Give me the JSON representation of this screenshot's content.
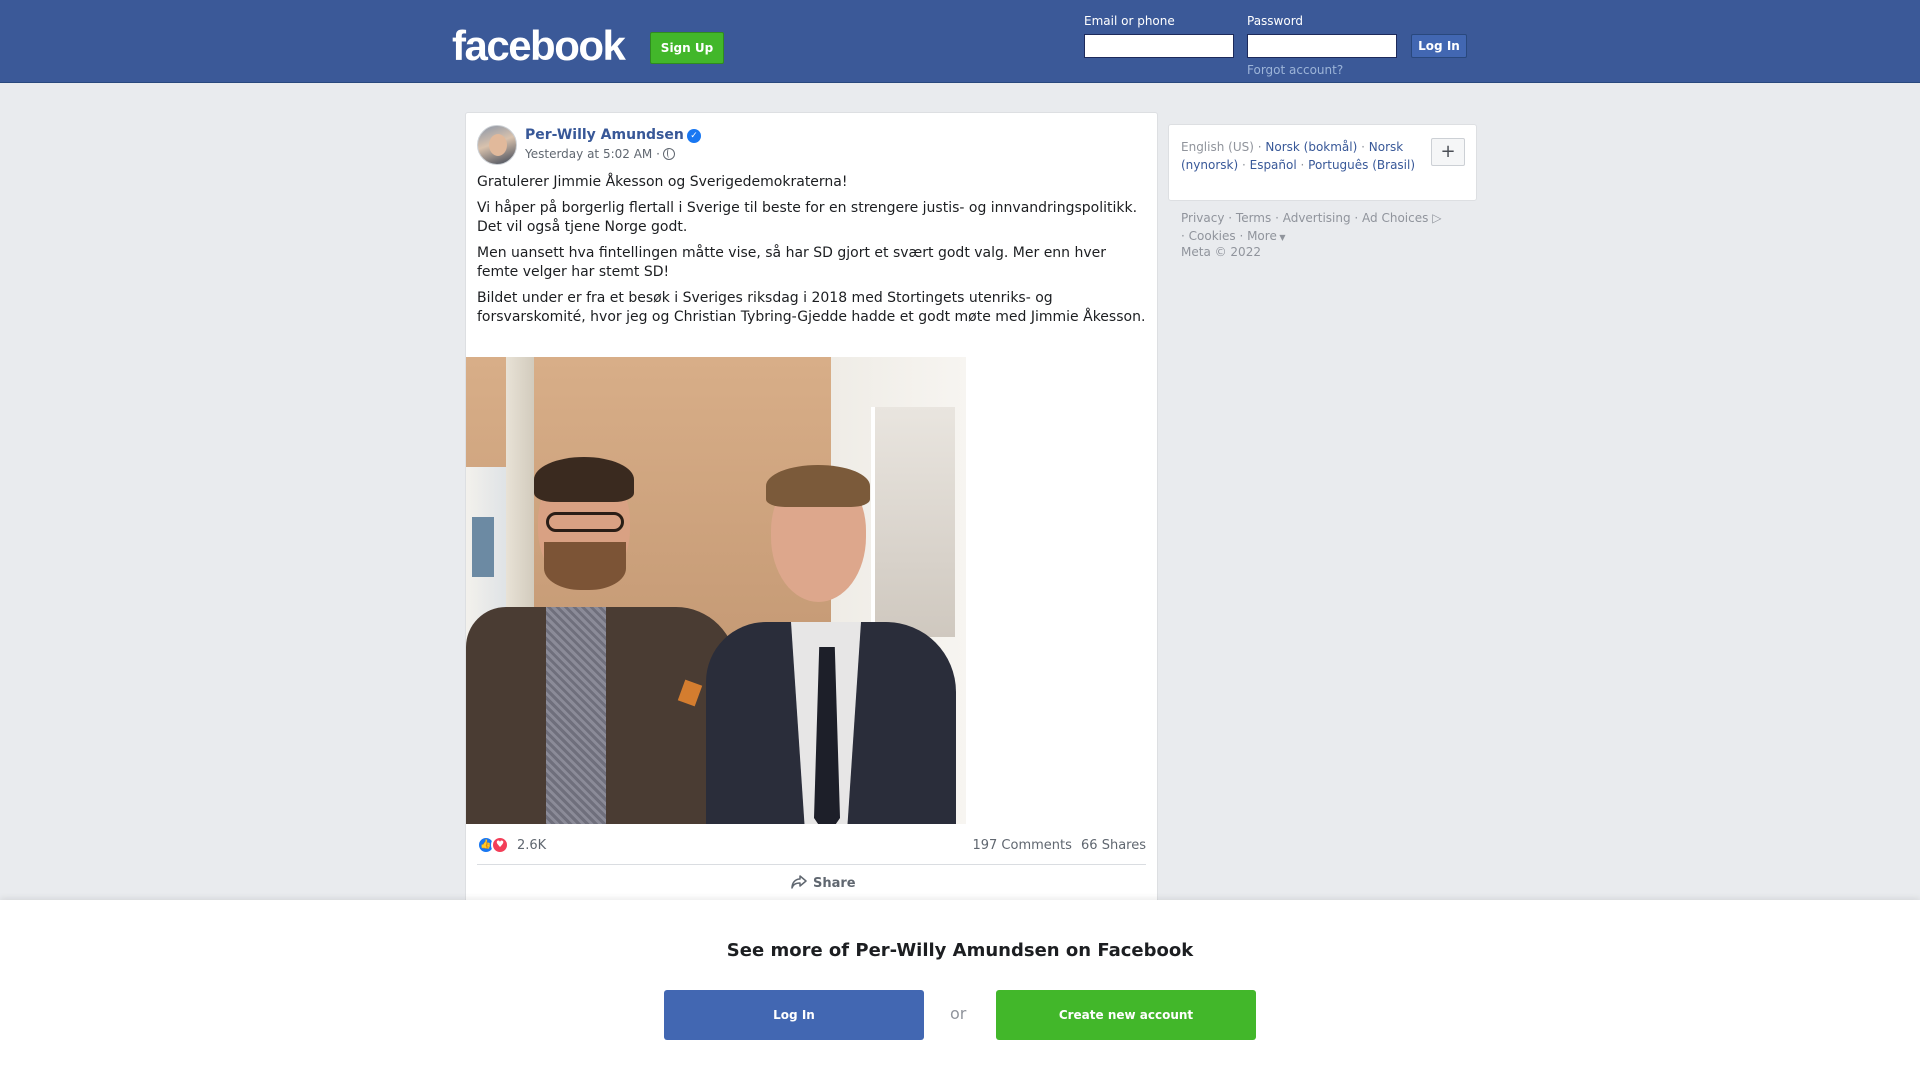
{
  "header": {
    "logo": "facebook",
    "signup_label": "Sign Up",
    "email_label": "Email or phone",
    "password_label": "Password",
    "login_label": "Log In",
    "forgot_label": "Forgot account?",
    "bg_color": "#3b5998"
  },
  "post": {
    "author": "Per-Willy Amundsen",
    "timestamp": "Yesterday at 5:02 AM ·",
    "paragraphs": [
      "Gratulerer Jimmie Åkesson og Sverigedemokraterna!",
      "Vi håper på borgerlig flertall i Sverige til beste for en strengere justis- og innvandringspolitikk. Det vil også tjene Norge godt.",
      "Men uansett hva fintellingen måtte vise, så har SD gjort et svært godt valg. Mer enn hver femte velger har stemt SD!",
      "Bildet under er fra et besøk i Sveriges riksdag i 2018 med Stortingets utenriks- og forsvarskomité, hvor jeg og Christian Tybring-Gjedde hadde et godt møte med Jimmie Åkesson."
    ],
    "reaction_count": "2.6K",
    "comments": "197 Comments",
    "shares": "66 Shares",
    "share_label": "Share"
  },
  "languages": {
    "current": "English (US) ·",
    "options": [
      "Norsk (bokmål)",
      "Norsk (nynorsk)",
      "Español",
      "Português (Brasil)"
    ],
    "plus_label": "+"
  },
  "footer": {
    "links": [
      "Privacy",
      "Terms",
      "Advertising",
      "Ad Choices",
      "Cookies",
      "More"
    ],
    "copyright": "Meta © 2022"
  },
  "overlay": {
    "title": "See more of Per-Willy Amundsen on Facebook",
    "login_label": "Log In",
    "or_label": "or",
    "create_label": "Create new account"
  }
}
